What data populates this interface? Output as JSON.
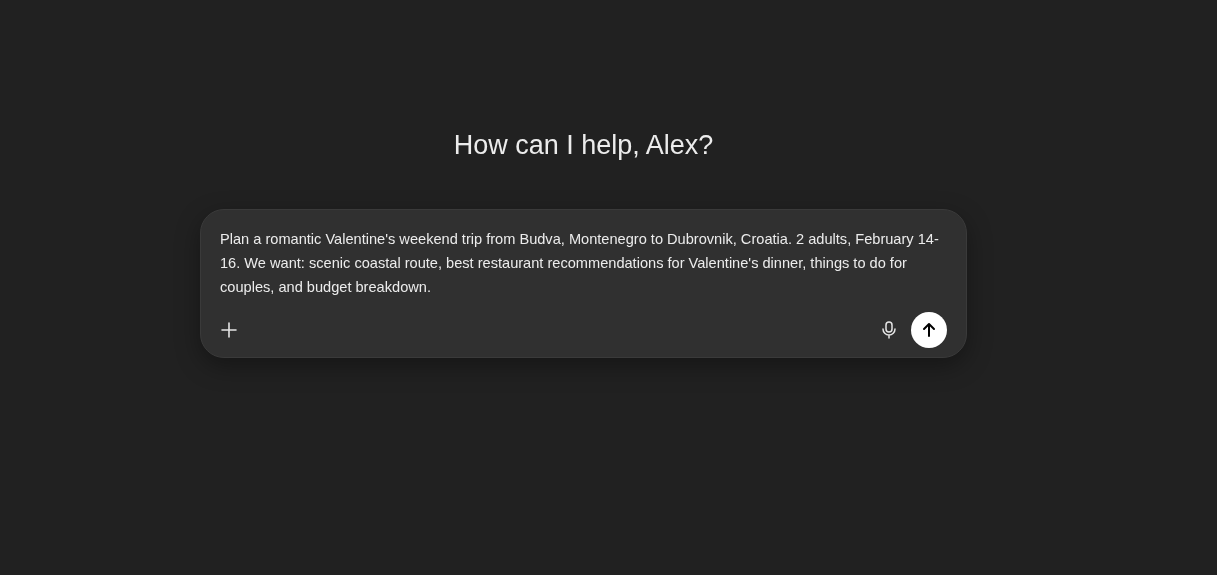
{
  "heading": "How can I help, Alex?",
  "composer": {
    "value": "Plan a romantic Valentine's weekend trip from Budva, Montenegro to Dubrovnik, Croatia. 2 adults, February 14-16. We want: scenic coastal route, best restaurant recommendations for Valentine's dinner, things to do for couples, and budget breakdown."
  }
}
